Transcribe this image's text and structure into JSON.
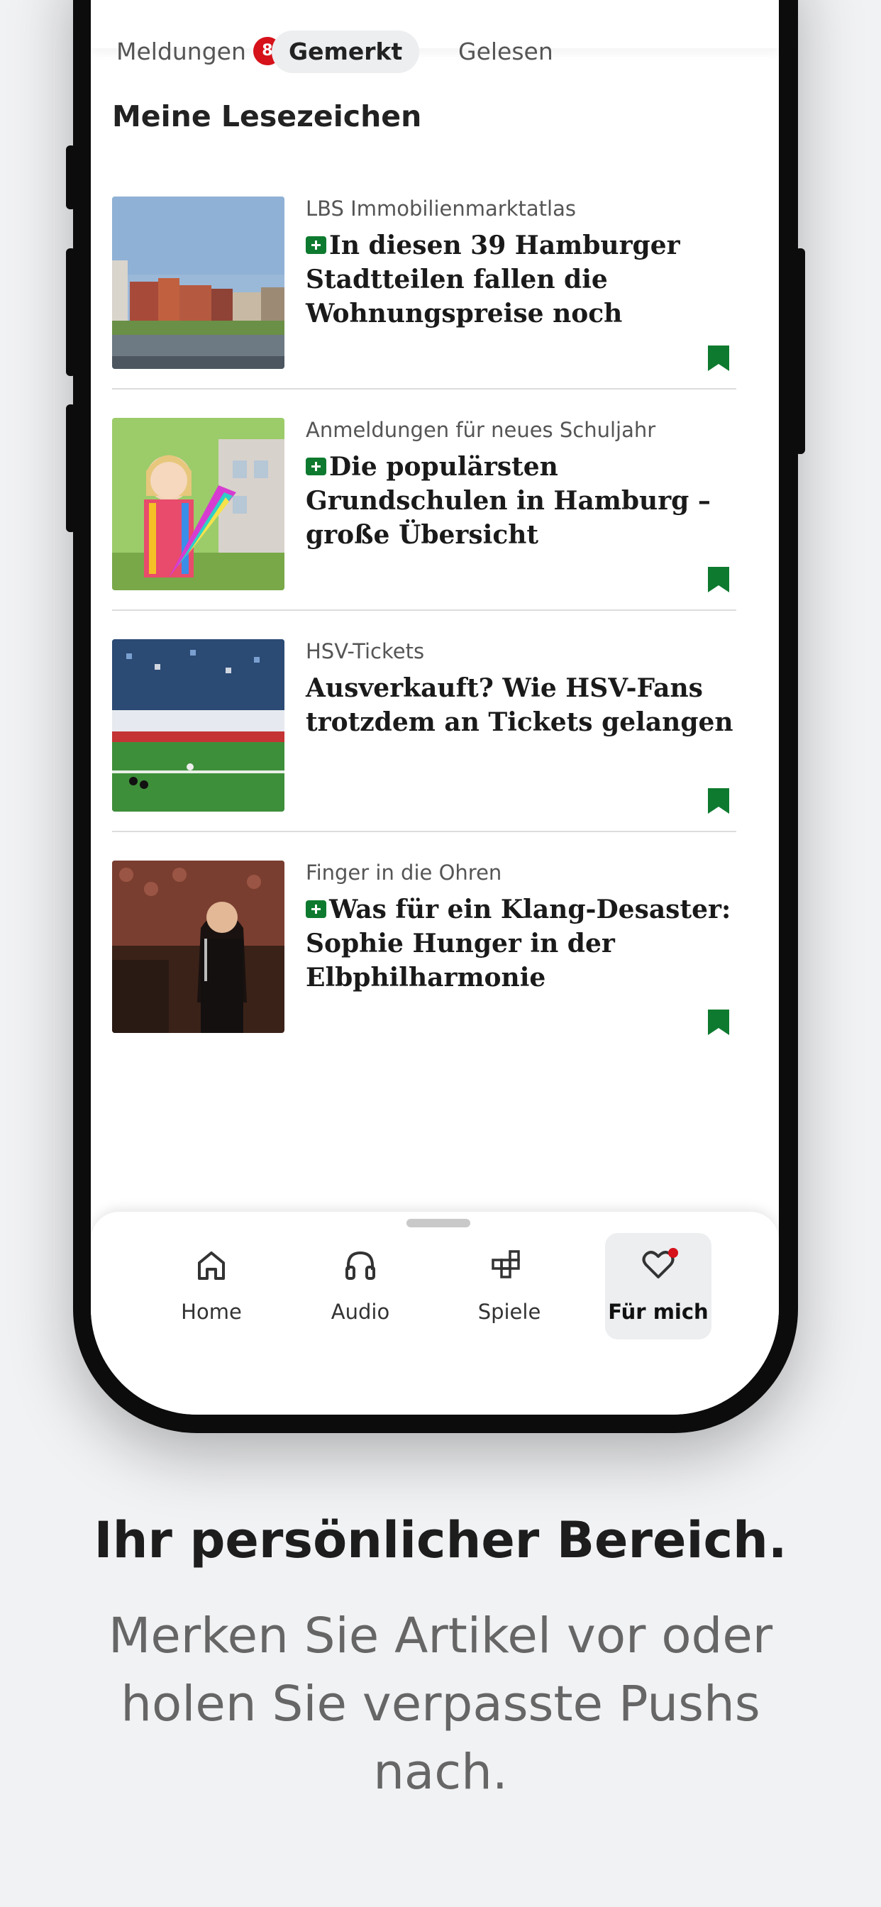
{
  "tabs": {
    "meldungen": "Meldungen",
    "meldungen_count": "8",
    "gemerkt": "Gemerkt",
    "gelesen": "Gelesen"
  },
  "section_title": "Meine Lesezeichen",
  "articles": [
    {
      "kicker": "LBS Immobilienmarktatlas",
      "headline": "In diesen 39 Hamburger Stadtteilen fallen die Wohnungspreise noch",
      "premium": true,
      "image": "hamburg-harbour-apartments-photo"
    },
    {
      "kicker": "Anmeldungen für neues Schuljahr",
      "headline": "Die populärsten Grundschulen in Hamburg – große Übersicht",
      "premium": true,
      "image": "girl-with-school-cone-photo"
    },
    {
      "kicker": "HSV-Tickets",
      "headline": "Ausverkauft? Wie HSV-Fans trotzdem an Tickets gelangen",
      "premium": false,
      "image": "stadium-crowd-photo"
    },
    {
      "kicker": "Finger in die Ohren",
      "headline": "Was für ein Klang-Desaster: Sophie Hunger in der Elbphilharmonie",
      "premium": true,
      "image": "singer-on-stage-photo"
    }
  ],
  "nav": {
    "home": "Home",
    "audio": "Audio",
    "spiele": "Spiele",
    "fuer_mich": "Für mich"
  },
  "colors": {
    "accent_green": "#0e7a2f",
    "badge_red": "#d6121a"
  },
  "promo": {
    "title": "Ihr persönlicher Bereich.",
    "subtitle": "Merken Sie Artikel vor oder holen Sie verpasste Pushs nach."
  }
}
